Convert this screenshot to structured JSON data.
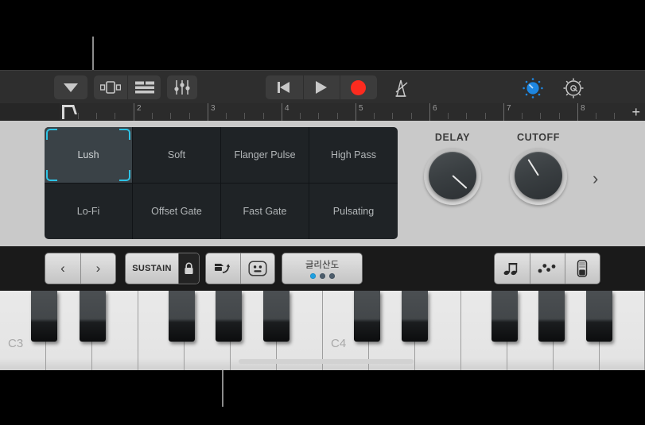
{
  "toolbar": {
    "dropdown_label": "library-chevron",
    "view_browser_label": "browser-view",
    "view_tracks_label": "tracks-view",
    "mixer_label": "mixer",
    "rewind_label": "rewind",
    "play_label": "play",
    "record_label": "record",
    "metronome_label": "metronome",
    "knob_view_label": "smart-controls",
    "gear_label": "settings",
    "record_color": "#fc2b1f",
    "accent_color": "#1e86e0"
  },
  "ruler": {
    "bars": [
      "2",
      "3",
      "4",
      "5",
      "6",
      "7",
      "8"
    ],
    "add_label": "+",
    "playhead_label": "playhead"
  },
  "smart_controls": {
    "presets": [
      {
        "label": "Lush",
        "selected": true
      },
      {
        "label": "Soft",
        "selected": false
      },
      {
        "label": "Flanger Pulse",
        "selected": false
      },
      {
        "label": "High Pass",
        "selected": false
      },
      {
        "label": "Lo-Fi",
        "selected": false
      },
      {
        "label": "Offset Gate",
        "selected": false
      },
      {
        "label": "Fast Gate",
        "selected": false
      },
      {
        "label": "Pulsating",
        "selected": false
      }
    ],
    "selection_color": "#2ec4e6",
    "knobs": [
      {
        "label": "DELAY",
        "angle": -48
      },
      {
        "label": "CUTOFF",
        "angle": 148
      }
    ],
    "next_arrow_label": "›"
  },
  "keyboard_bar": {
    "prev_label": "‹",
    "next_label": "›",
    "sustain_label": "SUSTAIN",
    "lock_label": "lock",
    "arpeggiator_toggle_label": "pitch-bend",
    "smiley_label": "smiley",
    "glissando_label": "글리산도",
    "glissando_dots": [
      "on",
      "off",
      "off"
    ],
    "note_button_label": "arpeggiator",
    "scale_button_label": "note-repeat",
    "velocity_button_label": "velocity"
  },
  "keyboard": {
    "octave_labels": [
      "C3",
      "C4"
    ],
    "white_key_count": 14,
    "highlight_label": "scroll-strip"
  }
}
